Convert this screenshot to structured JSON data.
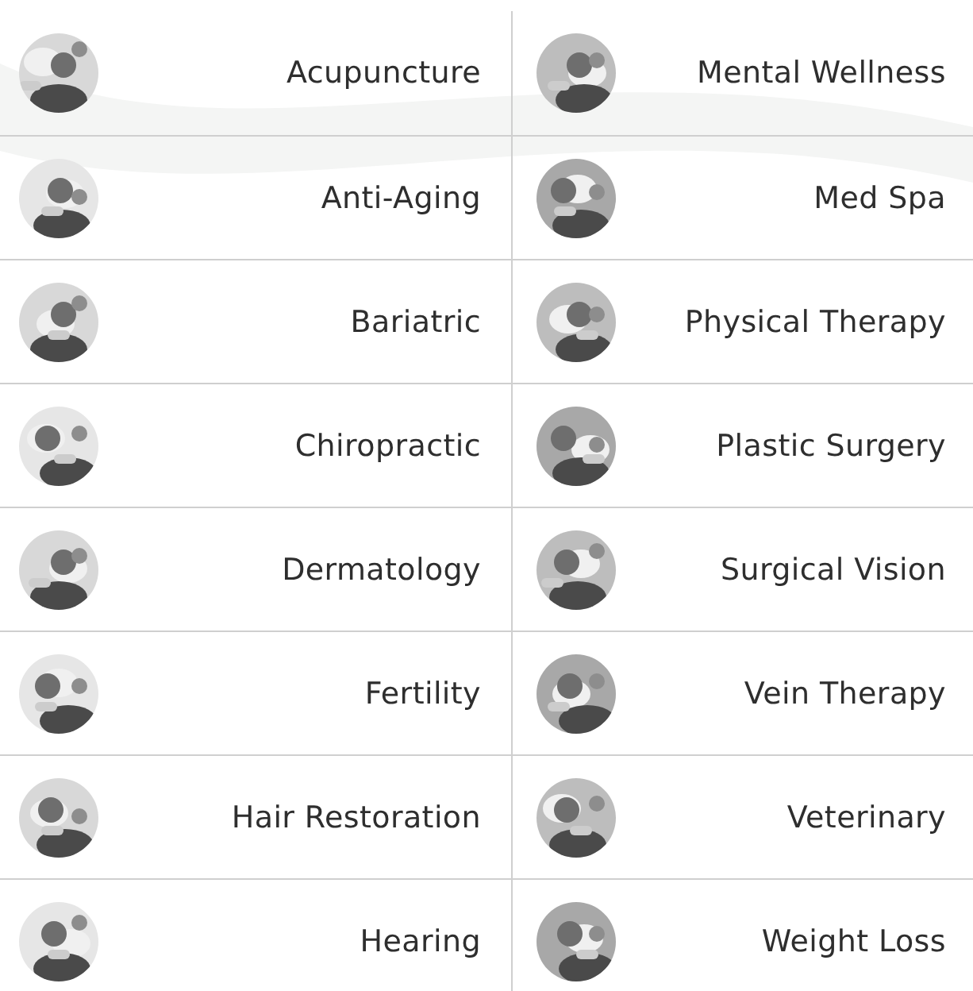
{
  "services": [
    {
      "label": "Acupuncture"
    },
    {
      "label": "Mental Wellness"
    },
    {
      "label": "Anti-Aging"
    },
    {
      "label": "Med Spa"
    },
    {
      "label": "Bariatric"
    },
    {
      "label": "Physical Therapy"
    },
    {
      "label": "Chiropractic"
    },
    {
      "label": "Plastic Surgery"
    },
    {
      "label": "Dermatology"
    },
    {
      "label": "Surgical Vision"
    },
    {
      "label": "Fertility"
    },
    {
      "label": "Vein Therapy"
    },
    {
      "label": "Hair Restoration"
    },
    {
      "label": "Veterinary"
    },
    {
      "label": "Hearing"
    },
    {
      "label": "Weight Loss"
    }
  ]
}
